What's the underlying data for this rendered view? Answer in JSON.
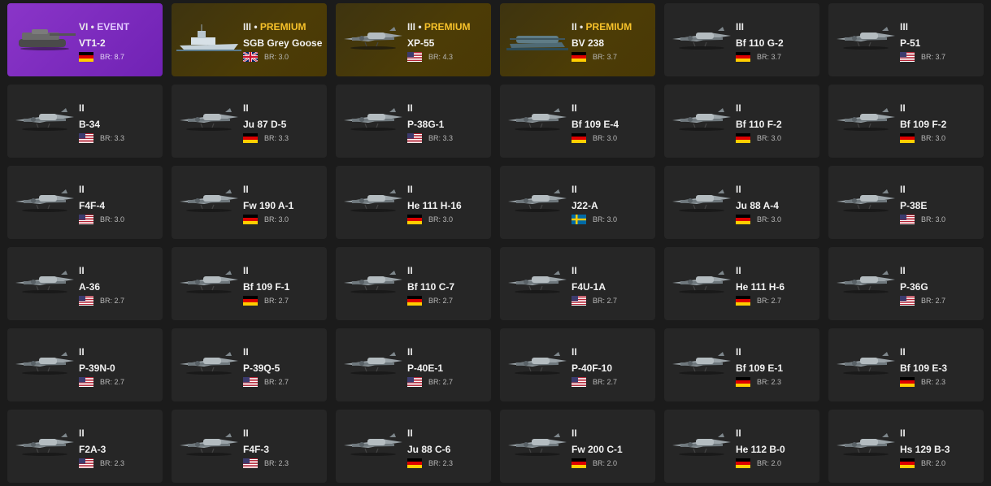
{
  "vehicles": [
    {
      "tier": "VI",
      "tag": "EVENT",
      "name": "VT1-2",
      "nation": "de",
      "br": "BR: 8.7",
      "kind": "event",
      "type": "tank"
    },
    {
      "tier": "III",
      "tag": "PREMIUM",
      "name": "SGB Grey Goose",
      "nation": "uk",
      "br": "BR: 3.0",
      "kind": "premium",
      "type": "ship"
    },
    {
      "tier": "III",
      "tag": "PREMIUM",
      "name": "XP-55",
      "nation": "us",
      "br": "BR: 4.3",
      "kind": "premium",
      "type": "plane"
    },
    {
      "tier": "II",
      "tag": "PREMIUM",
      "name": "BV 238",
      "nation": "de",
      "br": "BR: 3.7",
      "kind": "premium",
      "type": "boat"
    },
    {
      "tier": "III",
      "tag": "",
      "name": "Bf 110 G-2",
      "nation": "de",
      "br": "BR: 3.7",
      "kind": "normal",
      "type": "plane"
    },
    {
      "tier": "III",
      "tag": "",
      "name": "P-51",
      "nation": "us",
      "br": "BR: 3.7",
      "kind": "normal",
      "type": "plane"
    },
    {
      "tier": "II",
      "tag": "",
      "name": "B-34",
      "nation": "us",
      "br": "BR: 3.3",
      "kind": "normal",
      "type": "plane"
    },
    {
      "tier": "II",
      "tag": "",
      "name": "Ju 87 D-5",
      "nation": "de",
      "br": "BR: 3.3",
      "kind": "normal",
      "type": "plane"
    },
    {
      "tier": "II",
      "tag": "",
      "name": "P-38G-1",
      "nation": "us",
      "br": "BR: 3.3",
      "kind": "normal",
      "type": "plane"
    },
    {
      "tier": "II",
      "tag": "",
      "name": "Bf 109 E-4",
      "nation": "de",
      "br": "BR: 3.0",
      "kind": "normal",
      "type": "plane"
    },
    {
      "tier": "II",
      "tag": "",
      "name": "Bf 110 F-2",
      "nation": "de",
      "br": "BR: 3.0",
      "kind": "normal",
      "type": "plane"
    },
    {
      "tier": "II",
      "tag": "",
      "name": "Bf 109 F-2",
      "nation": "de",
      "br": "BR: 3.0",
      "kind": "normal",
      "type": "plane"
    },
    {
      "tier": "II",
      "tag": "",
      "name": "F4F-4",
      "nation": "us",
      "br": "BR: 3.0",
      "kind": "normal",
      "type": "plane"
    },
    {
      "tier": "II",
      "tag": "",
      "name": "Fw 190 A-1",
      "nation": "de",
      "br": "BR: 3.0",
      "kind": "normal",
      "type": "plane"
    },
    {
      "tier": "II",
      "tag": "",
      "name": "He 111 H-16",
      "nation": "de",
      "br": "BR: 3.0",
      "kind": "normal",
      "type": "plane"
    },
    {
      "tier": "II",
      "tag": "",
      "name": "J22-A",
      "nation": "se",
      "br": "BR: 3.0",
      "kind": "normal",
      "type": "plane"
    },
    {
      "tier": "II",
      "tag": "",
      "name": "Ju 88 A-4",
      "nation": "de",
      "br": "BR: 3.0",
      "kind": "normal",
      "type": "plane"
    },
    {
      "tier": "II",
      "tag": "",
      "name": "P-38E",
      "nation": "us",
      "br": "BR: 3.0",
      "kind": "normal",
      "type": "plane"
    },
    {
      "tier": "II",
      "tag": "",
      "name": "A-36",
      "nation": "us",
      "br": "BR: 2.7",
      "kind": "normal",
      "type": "plane"
    },
    {
      "tier": "II",
      "tag": "",
      "name": "Bf 109 F-1",
      "nation": "de",
      "br": "BR: 2.7",
      "kind": "normal",
      "type": "plane"
    },
    {
      "tier": "II",
      "tag": "",
      "name": "Bf 110 C-7",
      "nation": "de",
      "br": "BR: 2.7",
      "kind": "normal",
      "type": "plane"
    },
    {
      "tier": "II",
      "tag": "",
      "name": "F4U-1A",
      "nation": "us",
      "br": "BR: 2.7",
      "kind": "normal",
      "type": "plane"
    },
    {
      "tier": "II",
      "tag": "",
      "name": "He 111 H-6",
      "nation": "de",
      "br": "BR: 2.7",
      "kind": "normal",
      "type": "plane"
    },
    {
      "tier": "II",
      "tag": "",
      "name": "P-36G",
      "nation": "us",
      "br": "BR: 2.7",
      "kind": "normal",
      "type": "plane"
    },
    {
      "tier": "II",
      "tag": "",
      "name": "P-39N-0",
      "nation": "us",
      "br": "BR: 2.7",
      "kind": "normal",
      "type": "plane"
    },
    {
      "tier": "II",
      "tag": "",
      "name": "P-39Q-5",
      "nation": "us",
      "br": "BR: 2.7",
      "kind": "normal",
      "type": "plane"
    },
    {
      "tier": "II",
      "tag": "",
      "name": "P-40E-1",
      "nation": "us",
      "br": "BR: 2.7",
      "kind": "normal",
      "type": "plane"
    },
    {
      "tier": "II",
      "tag": "",
      "name": "P-40F-10",
      "nation": "us",
      "br": "BR: 2.7",
      "kind": "normal",
      "type": "plane"
    },
    {
      "tier": "II",
      "tag": "",
      "name": "Bf 109 E-1",
      "nation": "de",
      "br": "BR: 2.3",
      "kind": "normal",
      "type": "plane"
    },
    {
      "tier": "II",
      "tag": "",
      "name": "Bf 109 E-3",
      "nation": "de",
      "br": "BR: 2.3",
      "kind": "normal",
      "type": "plane"
    },
    {
      "tier": "II",
      "tag": "",
      "name": "F2A-3",
      "nation": "us",
      "br": "BR: 2.3",
      "kind": "normal",
      "type": "plane"
    },
    {
      "tier": "II",
      "tag": "",
      "name": "F4F-3",
      "nation": "us",
      "br": "BR: 2.3",
      "kind": "normal",
      "type": "plane"
    },
    {
      "tier": "II",
      "tag": "",
      "name": "Ju 88 C-6",
      "nation": "de",
      "br": "BR: 2.3",
      "kind": "normal",
      "type": "plane"
    },
    {
      "tier": "II",
      "tag": "",
      "name": "Fw 200 C-1",
      "nation": "de",
      "br": "BR: 2.0",
      "kind": "normal",
      "type": "plane"
    },
    {
      "tier": "II",
      "tag": "",
      "name": "He 112 B-0",
      "nation": "de",
      "br": "BR: 2.0",
      "kind": "normal",
      "type": "plane"
    },
    {
      "tier": "II",
      "tag": "",
      "name": "Hs 129 B-3",
      "nation": "de",
      "br": "BR: 2.0",
      "kind": "normal",
      "type": "plane"
    }
  ],
  "colors": {
    "event": "#7a2bc0",
    "premium_tag": "#f6c12a",
    "card": "#262626",
    "background": "#1b1b1b"
  }
}
